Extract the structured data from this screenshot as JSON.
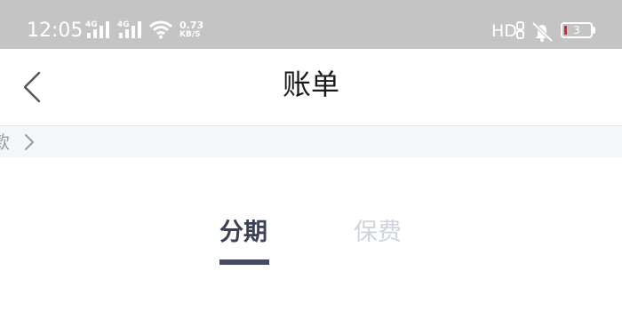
{
  "status_bar": {
    "time": "12:05",
    "network_1": "4G",
    "network_2": "4G",
    "speed_value": "0.73",
    "speed_unit": "KB/S",
    "hd_label": "HD",
    "battery_level": "3",
    "icons": [
      "signal-4g-icon",
      "signal-4g-icon",
      "wifi-icon",
      "hd-voice-icon",
      "mute-icon",
      "battery-icon"
    ],
    "background_color": "#c4c4c4",
    "battery_low_color": "#e0262d"
  },
  "nav": {
    "title": "账单",
    "back_icon": "chevron-left-icon"
  },
  "notice": {
    "text": "款",
    "chevron_icon": "chevron-right-icon"
  },
  "tabs": [
    {
      "label": "分期",
      "active": true
    },
    {
      "label": "保费",
      "active": false
    }
  ],
  "colors": {
    "tab_active": "#3b4257",
    "tab_inactive": "#cfd3db",
    "indicator": "#434a62",
    "notice_bg": "#f5f6f8"
  }
}
